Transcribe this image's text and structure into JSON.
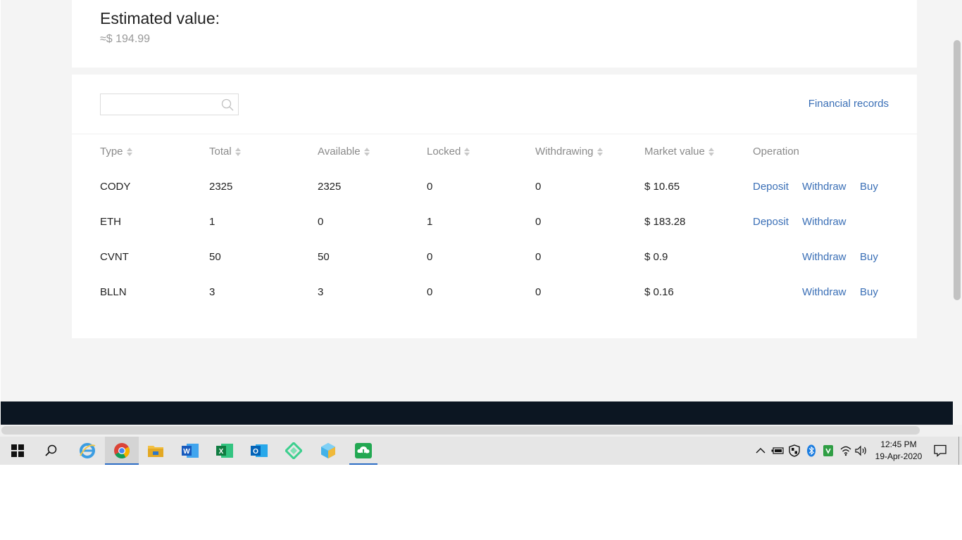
{
  "summary": {
    "title": "Estimated value:",
    "value": "≈$ 194.99"
  },
  "search": {
    "placeholder": ""
  },
  "links": {
    "financial_records": "Financial records"
  },
  "table": {
    "headers": {
      "type": "Type",
      "total": "Total",
      "available": "Available",
      "locked": "Locked",
      "withdrawing": "Withdrawing",
      "market_value": "Market value",
      "operation": "Operation"
    },
    "rows": [
      {
        "type": "CODY",
        "total": "2325",
        "available": "2325",
        "locked": "0",
        "withdrawing": "0",
        "market_value": "$ 10.65",
        "deposit": "Deposit",
        "withdraw": "Withdraw",
        "buy": "Buy"
      },
      {
        "type": "ETH",
        "total": "1",
        "available": "0",
        "locked": "1",
        "withdrawing": "0",
        "market_value": "$ 183.28",
        "deposit": "Deposit",
        "withdraw": "Withdraw",
        "buy": null
      },
      {
        "type": "CVNT",
        "total": "50",
        "available": "50",
        "locked": "0",
        "withdrawing": "0",
        "market_value": "$ 0.9",
        "deposit": null,
        "withdraw": "Withdraw",
        "buy": "Buy"
      },
      {
        "type": "BLLN",
        "total": "3",
        "available": "3",
        "locked": "0",
        "withdrawing": "0",
        "market_value": "$ 0.16",
        "deposit": null,
        "withdraw": "Withdraw",
        "buy": "Buy"
      }
    ]
  },
  "colors": {
    "link": "#3a6fb6",
    "footer": "#0c1622",
    "page_background": "#f4f4f4"
  },
  "taskbar": {
    "apps": [
      "windows-start-icon",
      "search-icon",
      "internet-explorer-icon",
      "chrome-icon",
      "file-explorer-icon",
      "word-icon",
      "excel-icon",
      "outlook-icon",
      "green-diamond-app-icon",
      "blue-cube-app-icon",
      "cloud-download-app-icon"
    ],
    "clock": {
      "time": "12:45 PM",
      "date": "19-Apr-2020"
    }
  }
}
